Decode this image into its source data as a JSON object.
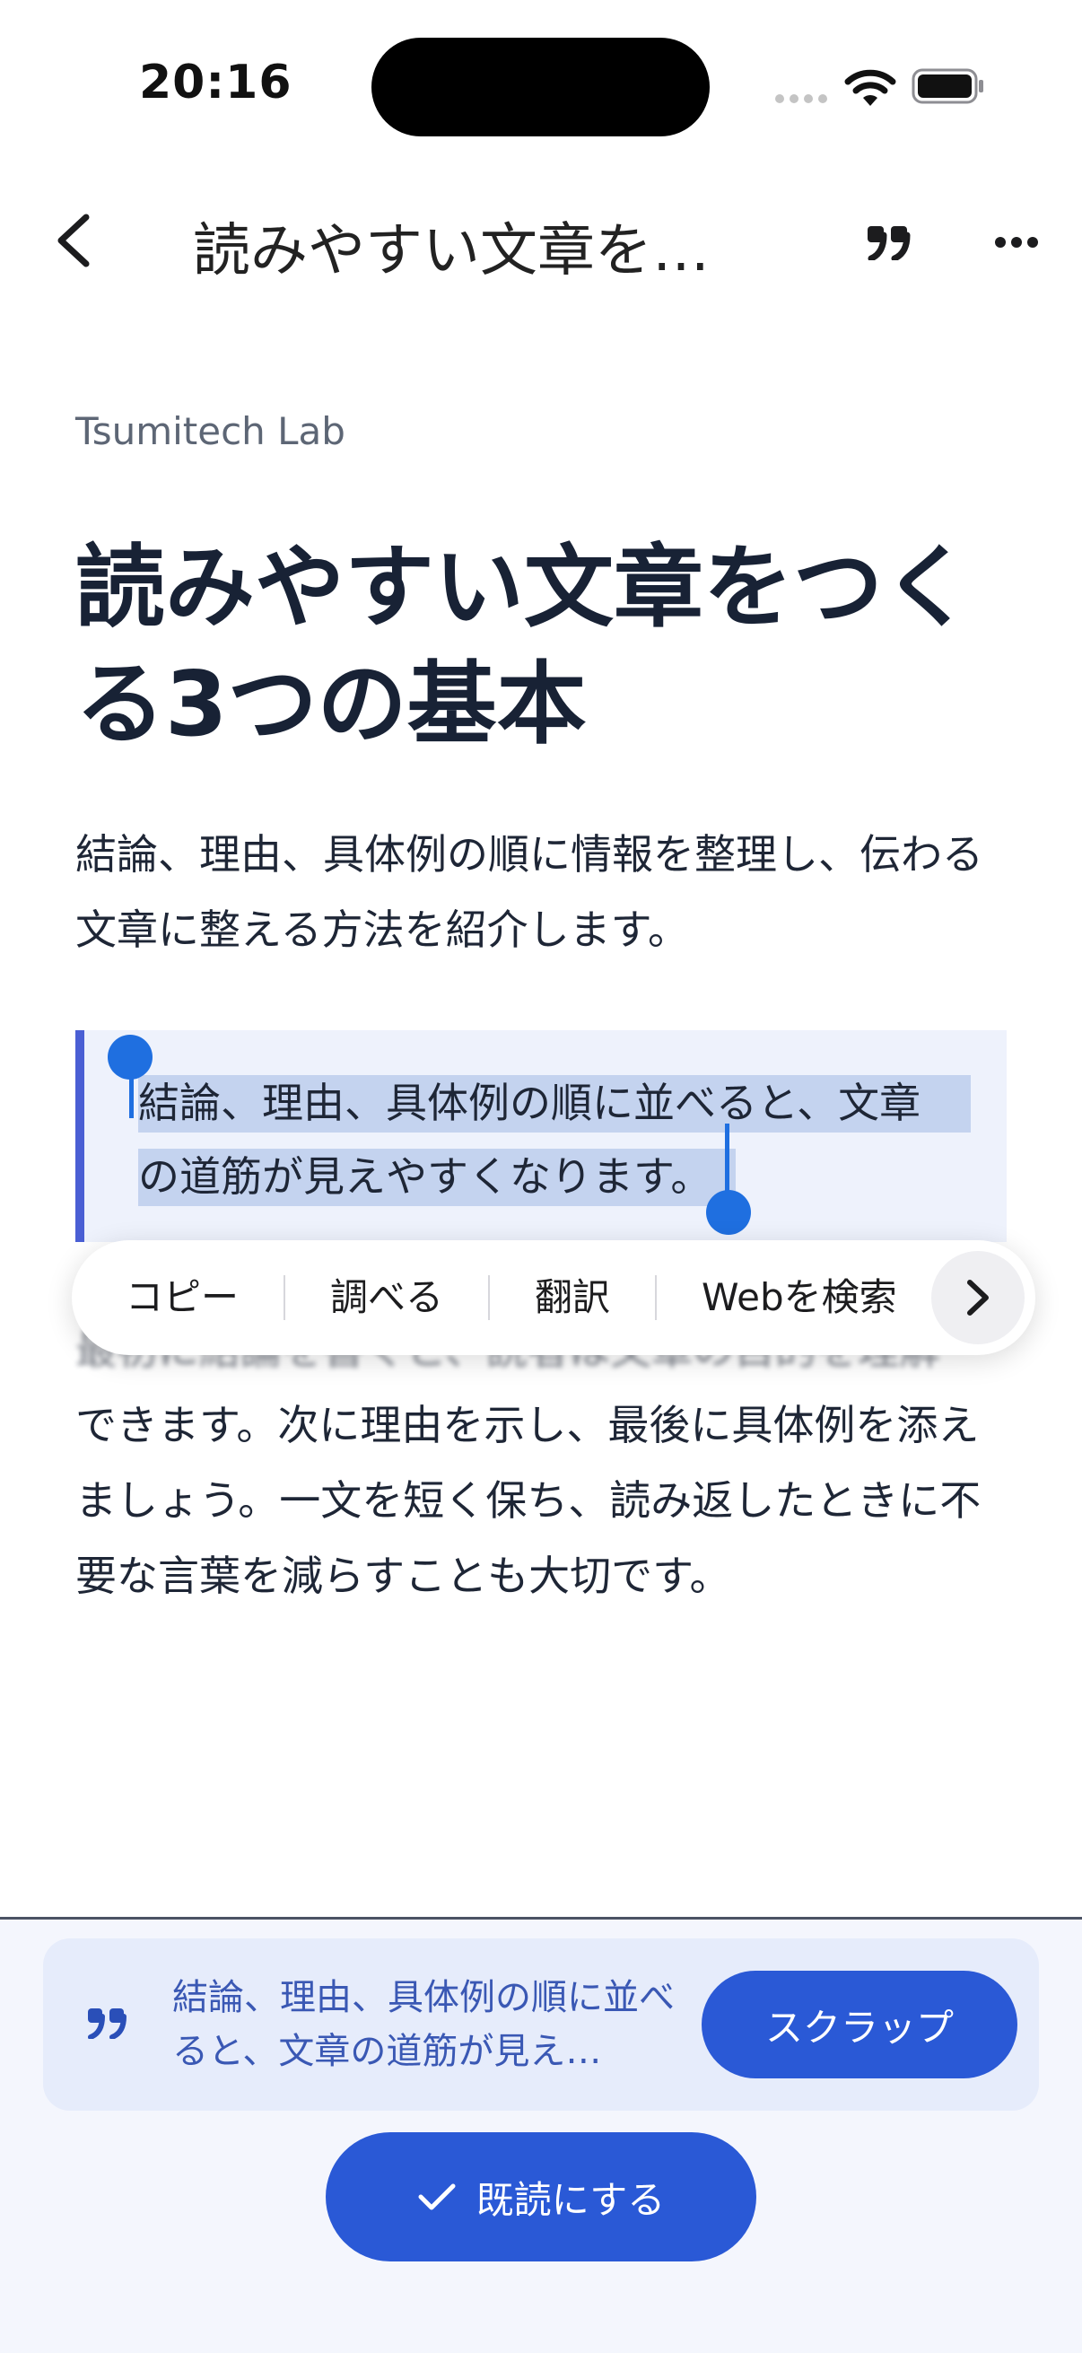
{
  "status_bar": {
    "time": "20:16"
  },
  "nav": {
    "title": "読みやすい文章を…",
    "back_icon": "chevron-left-icon",
    "quote_icon": "quote-icon",
    "more_icon": "more-icon"
  },
  "article": {
    "site": "Tsumitech Lab",
    "title": "読みやすい文章をつくる3つの基本",
    "lead": "結論、理由、具体例の順に情報を整理し、伝わる文章に整える方法を紹介します。",
    "quote_line1": "結論、理由、具体例の順に並べると、文章",
    "quote_line2": "の道筋が見えやすくなります。",
    "body_hidden": "最初に結論を書くと、読者は文章の目的を理解",
    "body_visible": "できます。次に理由を示し、最後に具体例を添えましょう。一文を短く保ち、読み返したときに不要な言葉を減らすことも大切です。"
  },
  "context_menu": {
    "items": [
      "コピー",
      "調べる",
      "翻訳",
      "Webを検索"
    ],
    "next_icon": "chevron-right-icon"
  },
  "bottom": {
    "scrap_text": "結論、理由、具体例の順に並べると、文章の道筋が見え…",
    "scrap_button": "スクラップ",
    "read_button": "既読にする",
    "read_icon": "checkmark-icon"
  },
  "colors": {
    "accent": "#2a59d6",
    "selection": "#c4d3ef",
    "quote_border": "#4a5fd4",
    "handle": "#1f6fe0"
  }
}
